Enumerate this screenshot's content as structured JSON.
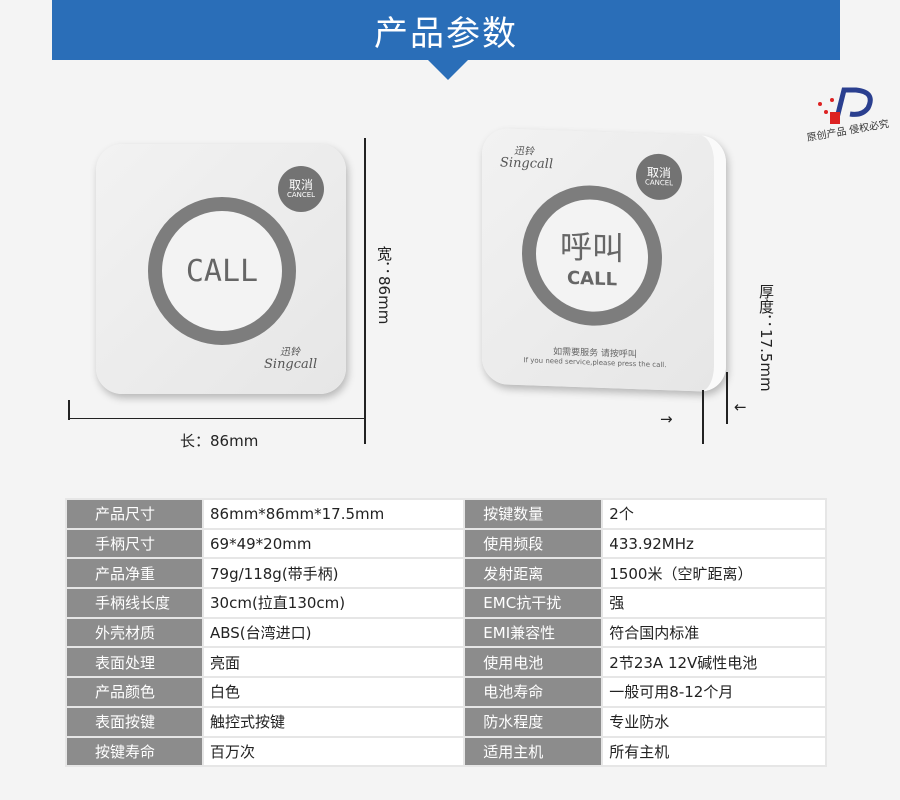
{
  "header": {
    "title": "产品参数"
  },
  "seal": {
    "text": "原创产品 侵权必究"
  },
  "front_device": {
    "call_label": "CALL",
    "cancel_cn": "取消",
    "cancel_en": "CANCEL",
    "brand_cn": "迅铃",
    "brand_en": "Singcall"
  },
  "side_device": {
    "call_cn": "呼叫",
    "call_label": "CALL",
    "cancel_cn": "取消",
    "cancel_en": "CANCEL",
    "brand_cn": "迅铃",
    "brand_en": "Singcall",
    "hint_cn": "如需要服务 请按呼叫",
    "hint_en": "If you need service,please press the call."
  },
  "dimensions": {
    "length": "长：86mm",
    "width": "宽：86mm",
    "thickness": "厚度：17.5mm"
  },
  "specs": [
    [
      "产品尺寸",
      "86mm*86mm*17.5mm",
      "按键数量",
      "2个"
    ],
    [
      "手柄尺寸",
      "69*49*20mm",
      "使用频段",
      "433.92MHz"
    ],
    [
      "产品净重",
      "79g/118g(带手柄)",
      "发射距离",
      "1500米（空旷距离）"
    ],
    [
      "手柄线长度",
      "30cm(拉直130cm)",
      "EMC抗干扰",
      "强"
    ],
    [
      "外壳材质",
      "ABS(台湾进口)",
      "EMI兼容性",
      "符合国内标准"
    ],
    [
      "表面处理",
      "亮面",
      "使用电池",
      "2节23A 12V碱性电池"
    ],
    [
      "产品颜色",
      "白色",
      "电池寿命",
      "一般可用8-12个月"
    ],
    [
      "表面按键",
      "触控式按键",
      "防水程度",
      "专业防水"
    ],
    [
      "按键寿命",
      "百万次",
      "适用主机",
      "所有主机"
    ]
  ]
}
